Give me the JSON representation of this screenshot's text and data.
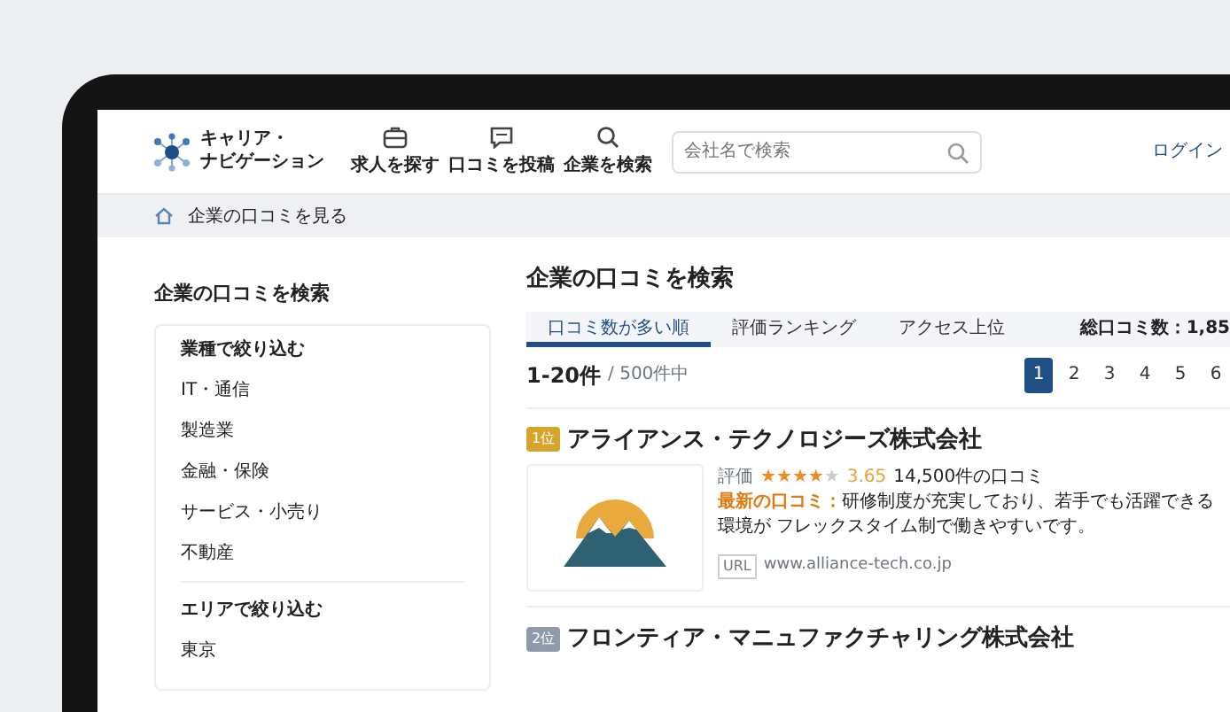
{
  "header": {
    "logo_lines": [
      "キャリア・",
      "ナビゲーション"
    ],
    "nav": [
      {
        "label": "求人を探す",
        "kind": "briefcase"
      },
      {
        "label": "口コミを投稿",
        "kind": "comment"
      },
      {
        "label": "企業を検索",
        "kind": "search"
      }
    ],
    "search": {
      "placeholder": "会社名で検索"
    },
    "login": "ログイン"
  },
  "breadcrumb": [
    "企業の口コミを見る"
  ],
  "sidebar": {
    "title": "企業の口コミを検索",
    "groups": [
      {
        "heading": "業種で絞り込む",
        "items": [
          "IT・通信",
          "製造業",
          "金融・保険",
          "サービス・小売り",
          "不動産"
        ]
      },
      {
        "heading": "エリアで絞り込む",
        "items": [
          "東京"
        ]
      }
    ]
  },
  "main": {
    "title": "企業の口コミを検索",
    "tabs": [
      {
        "label": "口コミ数が多い順",
        "selected": true
      },
      {
        "label": "評価ランキング",
        "selected": false
      },
      {
        "label": "アクセス上位",
        "selected": false
      }
    ],
    "total": "総口コミ数：1,85",
    "range": "1-20件",
    "range_total": "/ 500件中",
    "pages": [
      {
        "label": "1",
        "selected": true
      },
      {
        "label": "2",
        "selected": false
      },
      {
        "label": "3",
        "selected": false
      },
      {
        "label": "4",
        "selected": false
      },
      {
        "label": "5",
        "selected": false
      },
      {
        "label": "6",
        "selected": false
      }
    ],
    "companies": [
      {
        "rank": "1位",
        "color": "#d6a62c",
        "name": "アライアンス・テクノロジーズ株式会社",
        "rating_label": "評価",
        "stars": 4,
        "score": "3.65",
        "reviews": "14,500件の口コミ",
        "latest_label": "最新の口コミ：",
        "latest": "研修制度が充実しており、若手でも活躍できる環境が フレックスタイム制で働きやすいです。",
        "url_label": "URL",
        "url": "www.alliance-tech.co.jp"
      },
      {
        "rank": "2位",
        "color": "#8f9aab",
        "name": "フロンティア・マニュファクチャリング株式会社"
      }
    ]
  }
}
